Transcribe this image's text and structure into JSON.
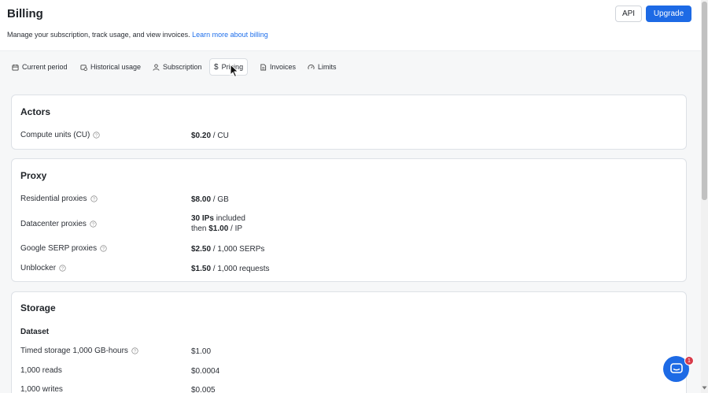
{
  "header": {
    "title": "Billing",
    "subtitle": "Manage your subscription, track usage, and view invoices.",
    "learn_more": "Learn more about billing",
    "api_label": "API",
    "upgrade_label": "Upgrade"
  },
  "tabs": [
    {
      "label": "Current period",
      "icon": "calendar-icon"
    },
    {
      "label": "Historical usage",
      "icon": "calendar-clock-icon"
    },
    {
      "label": "Subscription",
      "icon": "user-icon"
    },
    {
      "label": "Pricing",
      "icon": "dollar-icon",
      "active": true
    },
    {
      "label": "Invoices",
      "icon": "document-icon"
    },
    {
      "label": "Limits",
      "icon": "gauge-icon"
    }
  ],
  "actors": {
    "title": "Actors",
    "rows": [
      {
        "label": "Compute units (CU)",
        "price": "$0.20",
        "unit": " / CU"
      }
    ]
  },
  "proxy": {
    "title": "Proxy",
    "residential": {
      "label": "Residential proxies",
      "price": "$8.00",
      "unit": " / GB"
    },
    "datacenter": {
      "label": "Datacenter proxies",
      "ips": "30 IPs",
      "included": " included",
      "then": "then ",
      "price": "$1.00",
      "unit": " / IP"
    },
    "serp": {
      "label": "Google SERP proxies",
      "price": "$2.50",
      "unit": " / 1,000 SERPs"
    },
    "unblocker": {
      "label": "Unblocker",
      "price": "$1.50",
      "unit": " / 1,000 requests"
    }
  },
  "storage": {
    "title": "Storage",
    "dataset_label": "Dataset",
    "rows": [
      {
        "label": "Timed storage 1,000 GB-hours",
        "value": "$1.00"
      },
      {
        "label": "1,000 reads",
        "value": "$0.0004"
      },
      {
        "label": "1,000 writes",
        "value": "$0.005"
      }
    ]
  },
  "chat": {
    "badge": "1"
  },
  "colors": {
    "accent": "#1d6ae5",
    "badge": "#d73a49"
  }
}
